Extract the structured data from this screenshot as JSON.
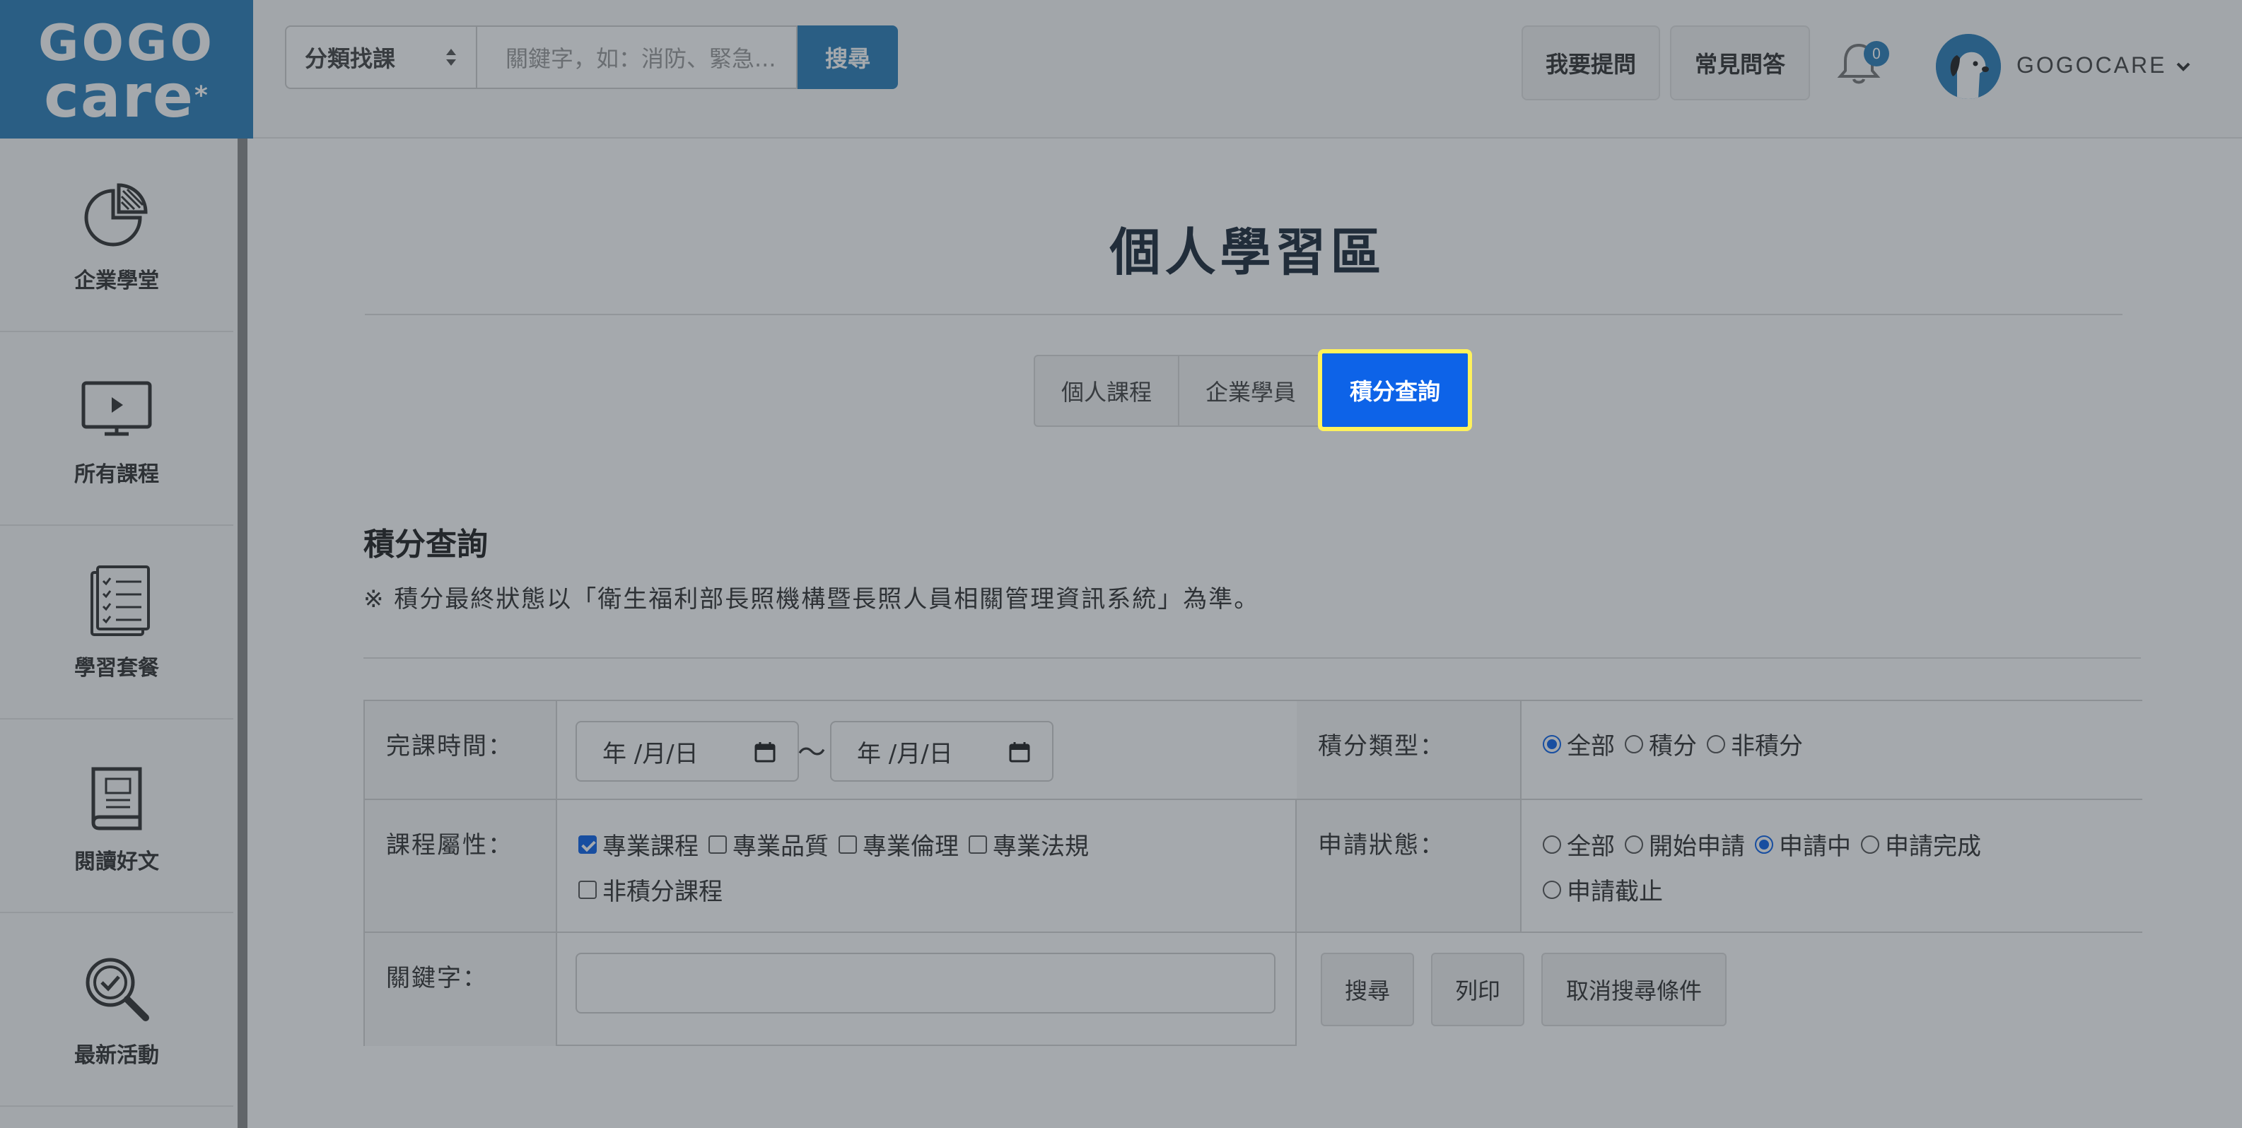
{
  "brand": {
    "logo_line1": "GOGO",
    "logo_line2": "care",
    "logo_mark": "*",
    "accent": "#2b7fb9"
  },
  "header": {
    "category_select": "分類找課",
    "search_placeholder": "關鍵字，如：消防、緊急...",
    "search_button": "搜尋",
    "ask_button": "我要提問",
    "faq_button": "常見問答",
    "notification_count": "0",
    "username": "GOGOCARE"
  },
  "sidebar": {
    "items": [
      {
        "label": "企業學堂",
        "icon": "pie-chart-icon"
      },
      {
        "label": "所有課程",
        "icon": "monitor-play-icon"
      },
      {
        "label": "學習套餐",
        "icon": "checklist-icon"
      },
      {
        "label": "閱讀好文",
        "icon": "book-icon"
      },
      {
        "label": "最新活動",
        "icon": "magnifier-check-icon"
      }
    ]
  },
  "main": {
    "title": "個人學習區",
    "tabs": [
      {
        "label": "個人課程",
        "active": false
      },
      {
        "label": "企業學員",
        "active": false
      },
      {
        "label": "積分查詢",
        "active": true
      }
    ],
    "section_title": "積分查詢",
    "notice": "※ 積分最終狀態以「衛生福利部長照機構暨長照人員相關管理資訊系統」為準。"
  },
  "form": {
    "completion_time_label": "完課時間：",
    "date_start_placeholder": "年 /月/日",
    "date_end_placeholder": "年 /月/日",
    "date_separator": "〜",
    "credit_type_label": "積分類型：",
    "credit_type_options": [
      {
        "label": "全部",
        "checked": true
      },
      {
        "label": "積分",
        "checked": false
      },
      {
        "label": "非積分",
        "checked": false
      }
    ],
    "course_attr_label": "課程屬性：",
    "course_attr_options": [
      {
        "label": "專業課程",
        "checked": true
      },
      {
        "label": "專業品質",
        "checked": false
      },
      {
        "label": "專業倫理",
        "checked": false
      },
      {
        "label": "專業法規",
        "checked": false
      },
      {
        "label": "非積分課程",
        "checked": false
      }
    ],
    "apply_status_label": "申請狀態：",
    "apply_status_options": [
      {
        "label": "全部",
        "checked": false
      },
      {
        "label": "開始申請",
        "checked": false
      },
      {
        "label": "申請中",
        "checked": true
      },
      {
        "label": "申請完成",
        "checked": false
      },
      {
        "label": "申請截止",
        "checked": false
      }
    ],
    "keyword_label": "關鍵字：",
    "keyword_value": "",
    "search_button": "搜尋",
    "print_button": "列印",
    "clear_button": "取消搜尋條件"
  }
}
